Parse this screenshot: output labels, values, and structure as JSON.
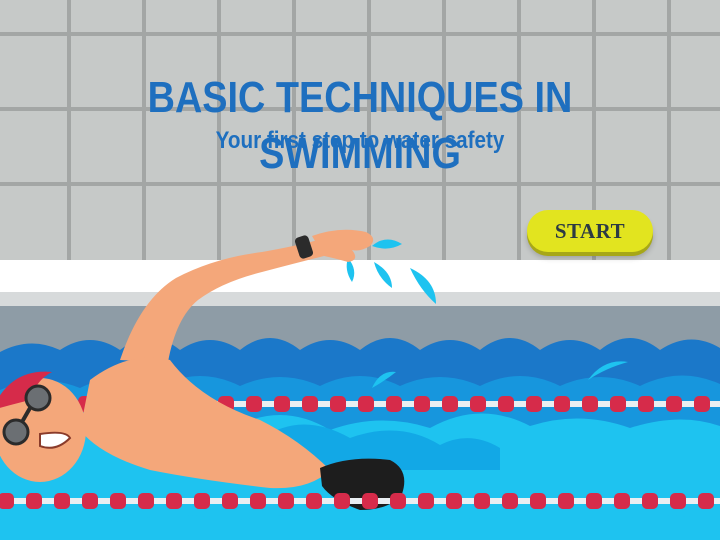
{
  "slide": {
    "title": "BASIC TECHNIQUES IN SWIMMING",
    "subtitle": "Your first step to water safety",
    "start_button_label": "START"
  },
  "colors": {
    "title_blue": "#1e6fbf",
    "button_yellow": "#e2e41f",
    "tile_gray": "#c6c9c8",
    "water_dark": "#1b78c9",
    "water_light": "#1ec3f0",
    "lane_rope_red": "#d62b4a"
  }
}
